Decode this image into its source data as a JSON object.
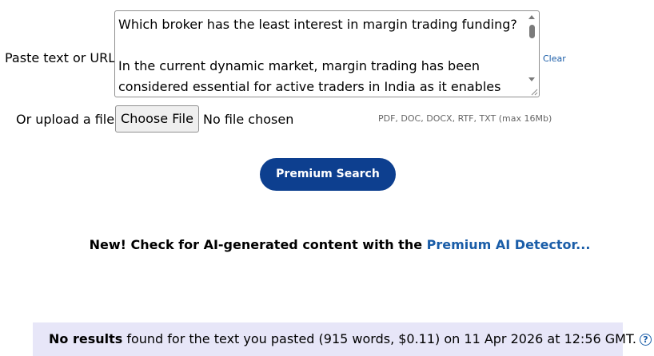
{
  "form": {
    "paste_label": "Paste text or URL:",
    "textarea_value": "Which broker has the least interest in margin trading funding?\n\nIn the current dynamic market, margin trading has been considered essential for active traders in India as it enables them to",
    "clear_label": "Clear",
    "upload_label": "Or upload a file:",
    "choose_file_label": "Choose File",
    "file_status": "No file chosen",
    "file_hint": "PDF, DOC, DOCX, RTF, TXT (max 16Mb)"
  },
  "search": {
    "button_label": "Premium Search"
  },
  "promo": {
    "prefix": "New! Check for AI-generated content with the ",
    "link_label": "Premium AI Detector..."
  },
  "results": {
    "bold_text": "No results",
    "message": " found for the text you pasted (915 words, $0.11) on 11 Apr 2026 at 12:56 GMT.",
    "help_icon": "?"
  },
  "colors": {
    "accent": "#0d3f8f",
    "link": "#1a5da8",
    "results_bg": "#e7e6f8"
  }
}
